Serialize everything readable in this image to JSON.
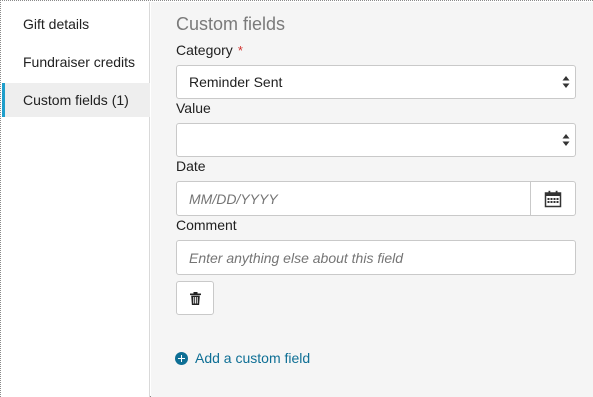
{
  "sidebar": {
    "items": [
      {
        "label": "Gift details"
      },
      {
        "label": "Fundraiser credits"
      },
      {
        "label": "Custom fields (1)"
      }
    ]
  },
  "main": {
    "title": "Custom fields",
    "category": {
      "label": "Category",
      "required_mark": "*",
      "value": "Reminder Sent"
    },
    "value_field": {
      "label": "Value",
      "value": ""
    },
    "date": {
      "label": "Date",
      "placeholder": "MM/DD/YYYY"
    },
    "comment": {
      "label": "Comment",
      "placeholder": "Enter anything else about this field"
    },
    "add_link": "Add a custom field"
  },
  "colors": {
    "accent": "#1f9ecb",
    "link": "#0e6f95",
    "required": "#d0312d",
    "panel_bg": "#f5f5f5"
  },
  "icons": [
    "caret-updown-icon",
    "calendar-icon",
    "trash-icon",
    "plus-circle-icon"
  ]
}
